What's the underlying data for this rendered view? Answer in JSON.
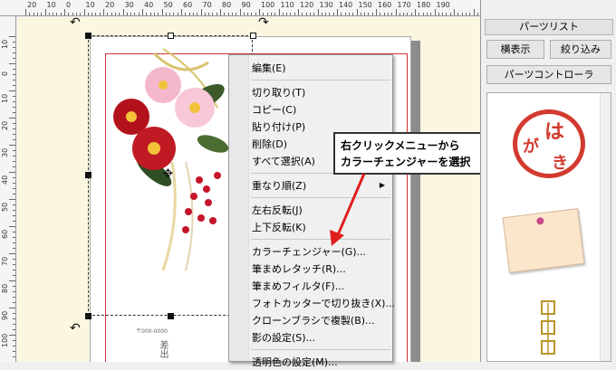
{
  "ruler_top": [
    "20",
    "10",
    "0",
    "10",
    "20",
    "30",
    "40",
    "50",
    "60",
    "70",
    "80",
    "90",
    "100",
    "110",
    "120",
    "130",
    "140",
    "150",
    "160",
    "170",
    "180",
    "190"
  ],
  "ruler_left": [
    "10",
    "0",
    "10",
    "20",
    "30",
    "40",
    "50",
    "60",
    "70",
    "80",
    "90",
    "100"
  ],
  "context_menu": {
    "items": [
      {
        "label": "編集(E)"
      },
      {
        "label": "切り取り(T)"
      },
      {
        "label": "コピー(C)"
      },
      {
        "label": "貼り付け(P)"
      },
      {
        "label": "削除(D)"
      },
      {
        "label": "すべて選択(A)"
      },
      {
        "label": "重なり順(Z)",
        "submenu_arrow": "▶"
      },
      {
        "label": "左右反転(J)"
      },
      {
        "label": "上下反転(K)"
      },
      {
        "label": "カラーチェンジャー(G)..."
      },
      {
        "label": "筆まめレタッチ(R)..."
      },
      {
        "label": "筆まめフィルタ(F)..."
      },
      {
        "label": "フォトカッターで切り抜き(X)..."
      },
      {
        "label": "クローンブラシで複製(B)..."
      },
      {
        "label": "影の設定(S)..."
      },
      {
        "label": "透明色の設定(M)..."
      }
    ]
  },
  "callout": {
    "line1": "右クリックメニューから",
    "line2": "カラーチェンジャーを選択"
  },
  "right_panel": {
    "title": "パーツリスト",
    "btn_show": "横表示",
    "btn_filter": "絞り込み",
    "btn_controller": "パーツコントローラ",
    "stamp_chars": [
      "は",
      "が",
      "き"
    ]
  },
  "card": {
    "postal": "〒000-0000",
    "sender": "差出"
  },
  "colors": {
    "accent_red": "#d23a30",
    "arrow_red": "#e01e1e",
    "workspace_bg": "#fbf6e0"
  }
}
